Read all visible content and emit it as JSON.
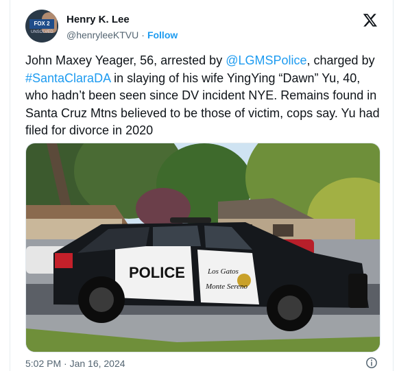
{
  "author": {
    "name": "Henry K. Lee",
    "handle": "@henryleeKTVU",
    "follow_label": "Follow",
    "separator": "·",
    "avatar_badge": "FOX 2",
    "avatar_sub": "UNSOLVED"
  },
  "tweet": {
    "part1": "John Maxey Yeager, 56, arrested by ",
    "mention": "@LGMSPolice",
    "part2": ", charged by ",
    "hashtag": "#SantaClaraDA",
    "part3": " in slaying of his wife YingYing “Dawn” Yu, 40, who hadn’t been seen since DV incident NYE. Remains found in Santa Cruz Mtns believed to be those of victim, cops say. Yu had filed for divorce in 2020"
  },
  "photo": {
    "door_text": "POLICE",
    "city_text_1": "Los Gatos",
    "city_text_2": "Monte Sereno"
  },
  "meta": {
    "timestamp": "5:02 PM · Jan 16, 2024"
  },
  "colors": {
    "link": "#1d9bf0",
    "text": "#0f1419",
    "muted": "#536471"
  },
  "icons": {
    "brand": "x-logo-icon",
    "info": "info-icon"
  }
}
